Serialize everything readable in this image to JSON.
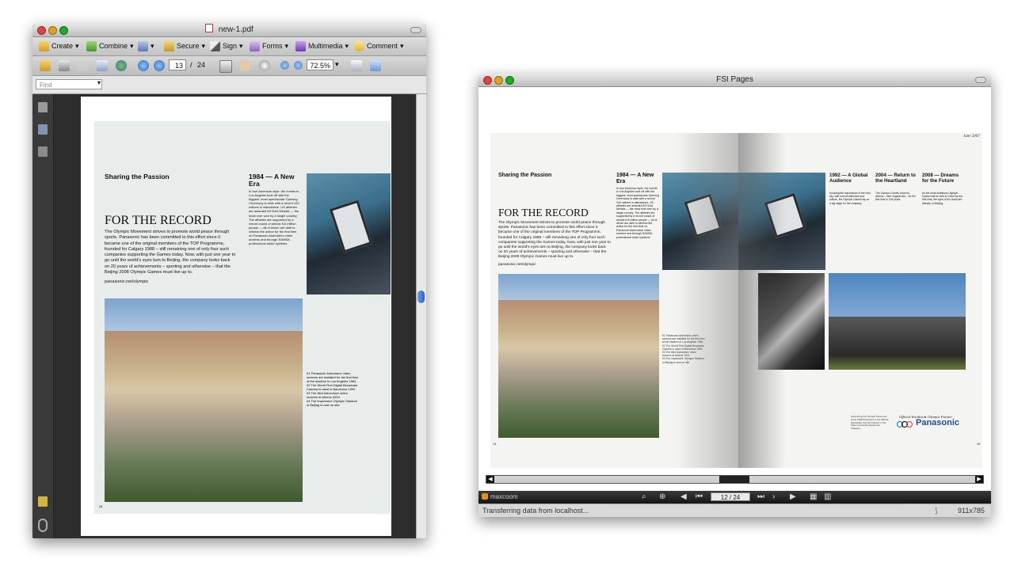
{
  "pdf_window": {
    "title": "new-1.pdf",
    "toolbar1": [
      {
        "label": "Create",
        "icon": "create-icon"
      },
      {
        "label": "Combine",
        "icon": "combine-icon"
      },
      {
        "label": "",
        "icon": "export-icon"
      },
      {
        "label": "Secure",
        "icon": "lock-icon"
      },
      {
        "label": "Sign",
        "icon": "pen-icon"
      },
      {
        "label": "Forms",
        "icon": "forms-icon"
      },
      {
        "label": "Multimedia",
        "icon": "multimedia-icon"
      },
      {
        "label": "Comment",
        "icon": "comment-icon"
      }
    ],
    "toolbar2": {
      "current_page": "13",
      "page_sep": "/",
      "total_pages": "24",
      "zoom": "72.5%"
    },
    "find_placeholder": "Find",
    "page_content": {
      "heading_small": "Sharing the Passion",
      "col1_title": "1984 — A New Era",
      "headline": "FOR THE RECORD",
      "body": "The Olympic Movement strives to promote world peace through sports. Panasonic has been committed to this effort since it became one of the original members of the TOP Programme, founded for Calgary 1988 – still remaining one of only four such companies supporting the Games today. Now, with just one year to go until the world's eyes turn to Beijing, the company looks back on 20 years of achievements – sporting and otherwise – that the Beijing 2008 Olympic Games must live up to.",
      "link": "panasonic.net/olympic",
      "col1_body": "In true American style, the events in Los Angeles took off with the biggest, most spectacular Opening Ceremony to date with a record 140 nations in attendance. US athletes are awarded 83 Gold Medals — the most ever won by a single country. The athletes are supported by a record crowd of almost 6.8 million people — all of whom are able to witness the action for the first time on Panasonic Astrovision video screens and through RAMSA professional audio systems.",
      "page_number": "24",
      "captions": [
        {
          "num": "01",
          "text": "Panasonic Astrovision video screens are installed for the first time at the stadium in Los Angeles 1984"
        },
        {
          "num": "02",
          "text": "The World First Digital Broadcast Camera is used in Barcelona 1992"
        },
        {
          "num": "03",
          "text": "The tiled Astrovision video screens at Athens 2004"
        },
        {
          "num": "04",
          "text": "The impressive Olympic Stadium in Beijing is new on site"
        }
      ]
    }
  },
  "fsi_window": {
    "title": "FSI Pages",
    "left_page": {
      "heading_small": "Sharing the Passion",
      "col1_title": "1984 — A New Era",
      "headline": "FOR THE RECORD",
      "body": "The Olympic Movement strives to promote world peace through sports. Panasonic has been committed to this effort since it became one of the original members of the TOP Programme, founded for Calgary 1988 – still remaining one of only four such companies supporting the Games today. Now, with just one year to go until the world's eyes turn to Beijing, the company looks back on 20 years of achievements – sporting and otherwise – that the Beijing 2008 Olympic Games must live up to.",
      "link": "panasonic.net/olympic",
      "page_number": "24"
    },
    "right_page": {
      "date": "June 2007",
      "cols": [
        {
          "title": "1992 — A Global Audience",
          "body": "Knowing the importance of the host city, with new architecture and culture, the Olympic Games lay on a big stage for the company."
        },
        {
          "title": "2004 — Return to the Heartland",
          "body": "The Olympic Games return to Athens – their original site – for the first time in 108 years."
        },
        {
          "title": "2008 — Dreams for the Future",
          "body": "As the most ambitious Olympic Games will be held in China for the first time, the eyes of the world are already on Beijing."
        }
      ],
      "partner_label": "Official Worldwide Olympic Partner",
      "partner_brand": "Panasonic",
      "support_text": "Supporting the Olympic Movement since 1988 Panasonic is the Official Worldwide Olympic Partner in the Video and Audio Equipment Category",
      "page_number": "25"
    },
    "toolbar": {
      "brand": "maxcoom",
      "page_display": "12 / 24"
    },
    "status_text": "Transferring data from localhost...",
    "dimensions": "911x785"
  },
  "colors": {
    "close": "#e0443e",
    "minimize": "#dea123",
    "maximize": "#1aab29",
    "panasonic_blue": "#1d4fa0"
  }
}
